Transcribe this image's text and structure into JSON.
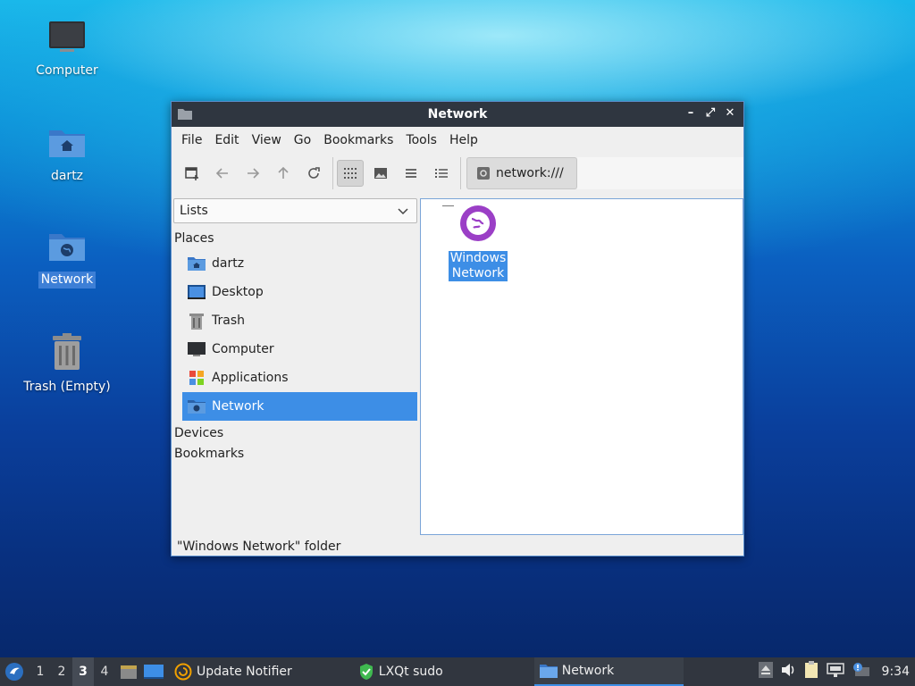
{
  "desktop": {
    "icons": [
      {
        "label": "Computer",
        "icon": "computer-icon"
      },
      {
        "label": "dartz",
        "icon": "home-folder-icon"
      },
      {
        "label": "Network",
        "icon": "network-folder-icon",
        "selected": true
      },
      {
        "label": "Trash (Empty)",
        "icon": "trash-icon"
      }
    ]
  },
  "window": {
    "title": "Network",
    "menu": [
      "File",
      "Edit",
      "View",
      "Go",
      "Bookmarks",
      "Tools",
      "Help"
    ],
    "path": "network:///",
    "side_mode": "Lists",
    "groups": {
      "places": "Places",
      "devices": "Devices",
      "bookmarks": "Bookmarks"
    },
    "places": [
      {
        "label": "dartz",
        "icon": "home-folder-icon"
      },
      {
        "label": "Desktop",
        "icon": "desktop-icon"
      },
      {
        "label": "Trash",
        "icon": "trash-icon"
      },
      {
        "label": "Computer",
        "icon": "computer-icon"
      },
      {
        "label": "Applications",
        "icon": "applications-icon"
      },
      {
        "label": "Network",
        "icon": "network-icon",
        "selected": true
      }
    ],
    "files": [
      {
        "line1": "Windows",
        "line2": "Network",
        "icon": "windows-network-icon"
      }
    ],
    "status": "\"Windows Network\" folder"
  },
  "taskbar": {
    "desktops": [
      "1",
      "2",
      "3",
      "4"
    ],
    "active_desktop": "3",
    "tasks": [
      {
        "label": "Update Notifier",
        "icon": "update-notifier-icon"
      },
      {
        "label": "LXQt sudo",
        "icon": "shield-icon"
      },
      {
        "label": "Network",
        "icon": "folder-icon",
        "active": true
      }
    ],
    "clock": "9:34"
  },
  "colors": {
    "accent": "#3d8ee6",
    "titlebar": "#2f3640",
    "taskbar": "#31363f"
  }
}
